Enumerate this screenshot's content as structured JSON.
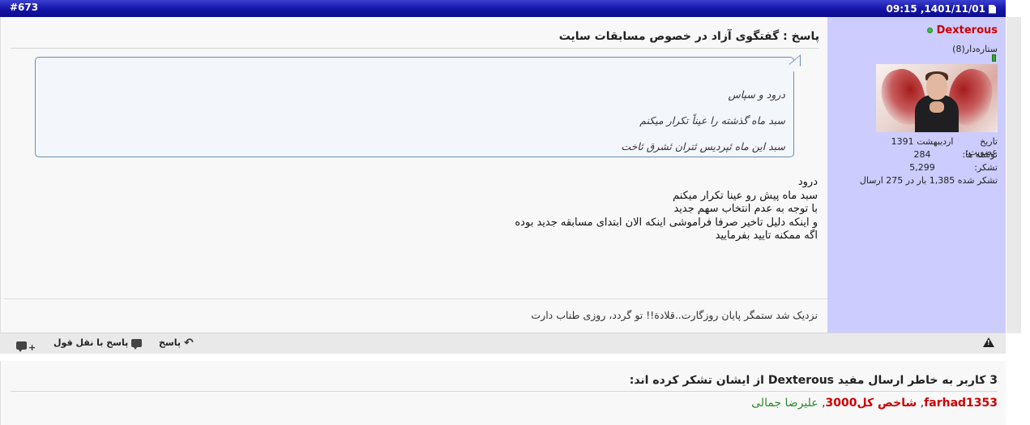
{
  "header": {
    "post_number": "#673",
    "date": "1401/11/01, 09:15",
    "date_display_ltr": "09:15 ,1401/11/01"
  },
  "post": {
    "title": "پاسخ : گفتگوی آزاد در خصوص مسابقات سایت",
    "quote_lines": [
      "درود و سپاس",
      "سبد ماه گذشته را عیناً تکرار میکنم",
      "سبد این ماه ئپردیس ئتران ئشرق ئاخت"
    ],
    "body_lines": [
      "درود",
      "سبد ماه پیش رو عینا تکرار میکنم",
      "با توجه به عدم انتخاب سهم جدید",
      "و اینکه دلیل تاخیر صرفا فراموشی اینکه الان ابتدای مسابقه جدید بوده",
      "اگه ممکنه تایید بفرمایید"
    ],
    "signature": "نزدیک شد ستمگر پایان روزگارت..قلادة!! تو گردد، روزی طناب دارت"
  },
  "user": {
    "name": "Dexterous",
    "rank": "ستاره‌دار(8)",
    "join_label": "تاریخ عضویت:",
    "join_value": "اردیبهشت 1391",
    "posts_label": "نوشته ها:",
    "posts_value": "284",
    "thanks_label": "تشکر:",
    "thanks_value": "5,299",
    "thanked_text": "تشکر شده 1,385 بار در 275 ارسال"
  },
  "footer": {
    "reply_label": "پاسخ",
    "quote_reply_label": "پاسخ با نقل قول"
  },
  "thanks": {
    "title": "3 کاربر به خاطر ارسال مفید Dexterous از ایشان تشکر کرده اند:",
    "users": [
      "farhad1353",
      "شاخص کل3000",
      "علیرضا جمالی"
    ],
    "separator": ", "
  },
  "colors": {
    "header_bar": "#1414a8",
    "user_panel": "#ccccfe",
    "username": "#cc0000",
    "online": "#3dbb3d"
  },
  "icons": {
    "post_doc": "document-icon",
    "online": "online-dot-icon",
    "reply": "reply-arrow-icon",
    "quote": "quote-bubble-icon",
    "multiquote": "multiquote-plus-icon",
    "report": "warning-triangle-icon"
  }
}
